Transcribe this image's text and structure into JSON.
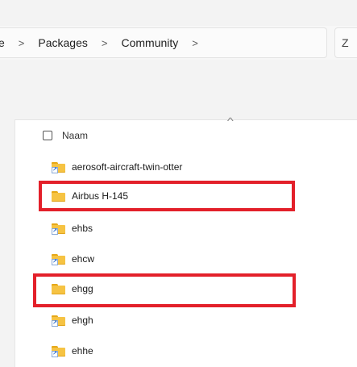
{
  "breadcrumb": {
    "crumbs": [
      "e",
      "Packages",
      "Community"
    ],
    "chevron_glyph": ">"
  },
  "search": {
    "partial_text": "Z"
  },
  "list": {
    "column_name": "Naam",
    "sort_glyph": "^",
    "items": [
      {
        "name": "aerosoft-aircraft-twin-otter",
        "icon": "folder-shortcut-icon",
        "highlighted": false
      },
      {
        "name": "Airbus H-145",
        "icon": "folder-icon",
        "highlighted": true
      },
      {
        "name": "ehbs",
        "icon": "folder-shortcut-icon",
        "highlighted": false
      },
      {
        "name": "ehcw",
        "icon": "folder-shortcut-icon",
        "highlighted": false
      },
      {
        "name": "ehgg",
        "icon": "folder-icon",
        "highlighted": true
      },
      {
        "name": "ehgh",
        "icon": "folder-shortcut-icon",
        "highlighted": false
      },
      {
        "name": "ehhe",
        "icon": "folder-shortcut-icon",
        "highlighted": false
      }
    ]
  },
  "colors": {
    "highlight": "#e3202a",
    "folder": "#f6c343",
    "shortcut_arrow": "#1a5fc6"
  }
}
